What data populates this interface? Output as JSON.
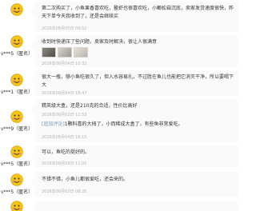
{
  "reviews": [
    {
      "username": "",
      "text": "第二次购买了，小鱼果香喜欢吃，鳌虾也很喜欢吃，小鲫松菇沉底，卖家发货速度很快，昨天下单今天我收到了，还是会继续买",
      "meta": "2016年09月05日 09:52",
      "images": []
    },
    {
      "username": "v***5（匿名）",
      "text": "收到时快递压了些问题，卖家及时解决，很让人很满意",
      "meta": "2016年09月04日 10:32",
      "images": [
        "photo-1",
        "photo-2",
        "photo-3"
      ]
    },
    {
      "username": "v***1（匿名）",
      "text": "很大一瓶，够小鱼吃很久了，但入水容易扎，不过胜在鱼儿也能把它消灭干净，所以要喝下大",
      "meta": "2016年09月04日 18:47",
      "images": []
    },
    {
      "username": "v***9（匿名）",
      "text": "精英级大盒，还是210克的合适，性价比高好",
      "meta": "2016年09月02日 11:53",
      "images": [],
      "followup_tag": "[追加评论]",
      "followup_text": "1颗料喜的大拇了，小而稀成大盒了，有些鱼非常爱吃。",
      "followup_meta": "2016年09月04日 16:15"
    },
    {
      "username": "v***5（匿名）",
      "text": "可以，鱼吃的挺好的。",
      "meta": "2016年09月03日 11:05",
      "images": []
    },
    {
      "username": "v***5（匿名）",
      "text": "不错不错，小鱼儿都很爱吃，还会来的。",
      "meta": "2016年09月02日 08:20",
      "images": []
    },
    {
      "username": "",
      "text": "",
      "meta": "",
      "images": []
    }
  ],
  "colors": {
    "avatar_face": "#f5c518",
    "avatar_outline": "#e0a800",
    "username_text": "#333333",
    "card_bg": "#fafafa",
    "followup_tag": "#6699cc",
    "meta_text": "#b3b3b3"
  },
  "icons": {
    "avatar": "smiley-avatar-icon"
  }
}
